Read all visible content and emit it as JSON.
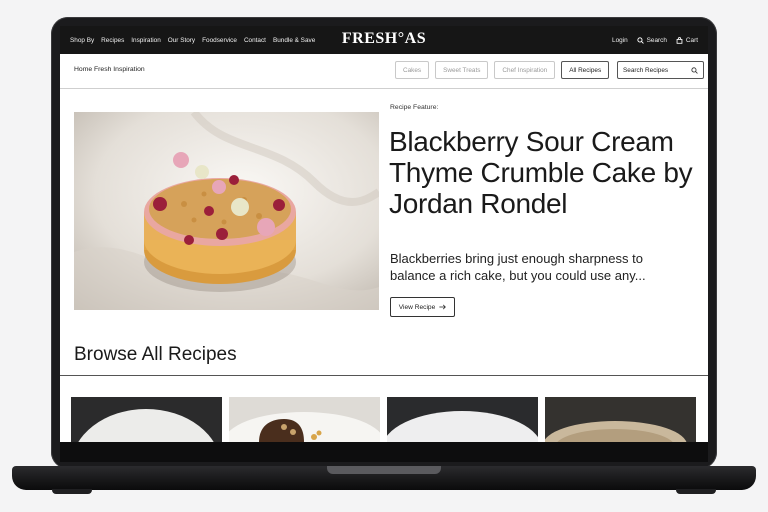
{
  "brand": {
    "logo": "FRESH°AS"
  },
  "nav": {
    "left": [
      "Shop By",
      "Recipes",
      "Inspiration",
      "Our Story",
      "Foodservice",
      "Contact",
      "Bundle & Save"
    ],
    "login": "Login",
    "search": "Search",
    "cart": "Cart"
  },
  "subnav": {
    "breadcrumb": "Home Fresh Inspiration",
    "filters": [
      "Cakes",
      "Sweet Treats",
      "Chef Inspiration",
      "All Recipes"
    ],
    "active_filter": "All Recipes",
    "search_placeholder": "Search Recipes"
  },
  "feature": {
    "label": "Recipe Feature:",
    "title": "Blackberry Sour Cream Thyme Crumble Cake by Jordan Rondel",
    "description": "Blackberries bring just enough sharpness to balance a rich cake, but you could use any...",
    "button": "View Recipe"
  },
  "browse": {
    "title": "Browse All Recipes"
  },
  "colors": {
    "topbar": "#161616",
    "accent_dark": "#1a1a1a",
    "device": "#1b1b1d"
  },
  "icons": [
    "search-icon",
    "cart-icon",
    "arrow-right-icon"
  ]
}
